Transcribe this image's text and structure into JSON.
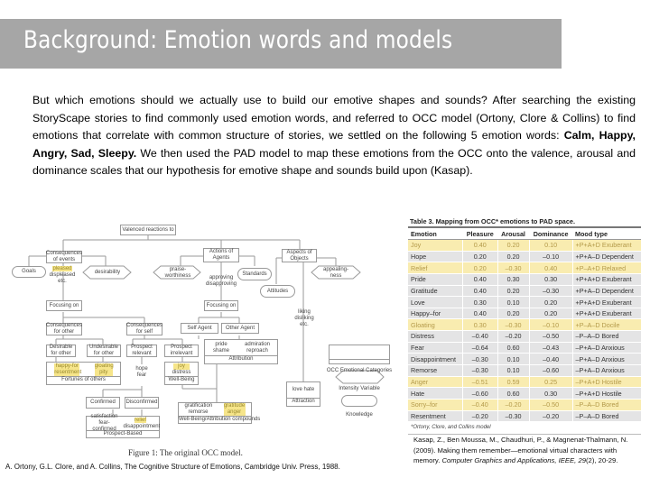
{
  "slide": {
    "title": "Background: Emotion words and models",
    "paragraph": {
      "line_parts": [
        "But which emotions should we actually use to build our emotive shapes and sounds? After searching the existing StoryScape stories to find commonly used emotion words, and referred to OCC model (Ortony, Clore & Collins) to find emotions that correlate with common structure of stories, we settled on the following 5 emotion words: ",
        "Calm, Happy, Angry, Sad, Sleepy.",
        " We then used the PAD model to map these emotions from the OCC onto the valence, arousal and dominance scales that our hypothesis for emotive shape and sounds build upon (Kasap)."
      ]
    }
  },
  "diagram": {
    "caption": "Figure 1: The original OCC model.",
    "reference": "A. Ortony, G.L. Clore, and A. Collins, The Cognitive Structure of Emotions, Cambridge Univ. Press, 1988.",
    "nodes": {
      "valenced": "Valenced reactions to",
      "consequences_events": "Consequences of events",
      "actions_agents": "Actions of Agents",
      "aspects_objects": "Aspects of Objects",
      "goals": "Goals",
      "pleased_hl": "pleased",
      "pleased_rest": "displeased etc.",
      "desirability": "desirability",
      "praiseworthiness": "praise-worthiness",
      "approving": "approving disapproving",
      "standards": "Standards",
      "appealingness": "appealing-ness",
      "attitudes": "Attitudes",
      "focusing_on_1": "Focusing on",
      "focusing_on_2": "Focusing on",
      "liking": "liking disliking etc.",
      "cons_other": "Consequences for other",
      "cons_self": "Consequences for self",
      "self_agent": "Self Agent",
      "other_agent": "Other Agent",
      "desirable_other": "Desirable for other",
      "undesirable_other": "Undesirable for other",
      "prospect_relevant": "Prospect relevant",
      "prospect_irrelevant": "Prospect irrelevant",
      "happy_for": "happy-for resentment",
      "gloating": "gloating pity",
      "fortunes": "Fortunes of others",
      "hope_fear": "hope fear",
      "joy": "joy",
      "distress": "distress",
      "well_being": "Well-Being",
      "pride_shame": "pride shame",
      "admiration": "admiration reproach",
      "attribution": "Attribution",
      "love_hate": "love hate",
      "attraction": "Attraction",
      "confirmed": "Confirmed",
      "disconfirmed": "Disconfirmed",
      "satisfaction": "satisfaction fear-confirmed",
      "relief": "relief",
      "disappointment": "disappointment",
      "prospect_based": "Prospect-Based",
      "gratification": "gratification remorse",
      "gratitude_anger": "gratitude anger",
      "wb_attr": "Well-Being/Attribution compounds"
    },
    "legend": {
      "categories": "OCC Emotional Categories",
      "intensity": "Intensity Variable",
      "knowledge": "Knowledge"
    }
  },
  "table": {
    "title": "Table 3. Mapping from OCC* emotions to PAD space.",
    "columns": [
      "Emotion",
      "Pleasure",
      "Arousal",
      "Dominance",
      "Mood type"
    ],
    "rows": [
      {
        "emotion": "Joy",
        "pleasure": "0.40",
        "arousal": "0.20",
        "dominance": "0.10",
        "mood": "+P+A+D Exuberant",
        "highlight": true
      },
      {
        "emotion": "Hope",
        "pleasure": "0.20",
        "arousal": "0.20",
        "dominance": "–0.10",
        "mood": "+P+A–D Dependent",
        "highlight": false
      },
      {
        "emotion": "Relief",
        "pleasure": "0.20",
        "arousal": "–0.30",
        "dominance": "0.40",
        "mood": "+P–A+D Relaxed",
        "highlight": true
      },
      {
        "emotion": "Pride",
        "pleasure": "0.40",
        "arousal": "0.30",
        "dominance": "0.30",
        "mood": "+P+A+D Exuberant",
        "highlight": false
      },
      {
        "emotion": "Gratitude",
        "pleasure": "0.40",
        "arousal": "0.20",
        "dominance": "–0.30",
        "mood": "+P+A–D Dependent",
        "highlight": false
      },
      {
        "emotion": "Love",
        "pleasure": "0.30",
        "arousal": "0.10",
        "dominance": "0.20",
        "mood": "+P+A+D Exuberant",
        "highlight": false
      },
      {
        "emotion": "Happy–for",
        "pleasure": "0.40",
        "arousal": "0.20",
        "dominance": "0.20",
        "mood": "+P+A+D Exuberant",
        "highlight": false
      },
      {
        "emotion": "Gloating",
        "pleasure": "0.30",
        "arousal": "–0.30",
        "dominance": "–0.10",
        "mood": "+P–A–D Docile",
        "highlight": true
      },
      {
        "emotion": "Distress",
        "pleasure": "–0.40",
        "arousal": "–0.20",
        "dominance": "–0.50",
        "mood": "–P–A–D Bored",
        "highlight": false
      },
      {
        "emotion": "Fear",
        "pleasure": "–0.64",
        "arousal": "0.60",
        "dominance": "–0.43",
        "mood": "–P+A–D Anxious",
        "highlight": false
      },
      {
        "emotion": "Disappointment",
        "pleasure": "–0.30",
        "arousal": "0.10",
        "dominance": "–0.40",
        "mood": "–P+A–D Anxious",
        "highlight": false
      },
      {
        "emotion": "Remorse",
        "pleasure": "–0.30",
        "arousal": "0.10",
        "dominance": "–0.60",
        "mood": "–P+A–D Anxious",
        "highlight": false
      },
      {
        "emotion": "Anger",
        "pleasure": "–0.51",
        "arousal": "0.59",
        "dominance": "0.25",
        "mood": "–P+A+D Hostile",
        "highlight": true
      },
      {
        "emotion": "Hate",
        "pleasure": "–0.60",
        "arousal": "0.60",
        "dominance": "0.30",
        "mood": "–P+A+D Hostile",
        "highlight": false
      },
      {
        "emotion": "Sorry–for",
        "pleasure": "–0.40",
        "arousal": "–0.20",
        "dominance": "–0.50",
        "mood": "–P–A–D Bored",
        "highlight": true
      },
      {
        "emotion": "Resentment",
        "pleasure": "–0.20",
        "arousal": "–0.30",
        "dominance": "–0.20",
        "mood": "–P–A–D Bored",
        "highlight": false
      }
    ],
    "footnote": "*Ortony, Clore, and Collins model"
  },
  "kasap_reference": {
    "authors": "Kasap, Z., Ben Moussa, M., Chaudhuri, P., & Magnenat-Thalmann, N. (2009). Making them remember—emotional virtual characters with memory. ",
    "journal": "Computer Graphics and Applications, IEEE, 29",
    "tail": "(2), 20-29."
  },
  "colors": {
    "title_bar": "#a6a6a6",
    "table_highlight": "#f9ecb0",
    "diagram_highlight": "#f6e58a",
    "table_row_grey": "#e4e4e5"
  }
}
